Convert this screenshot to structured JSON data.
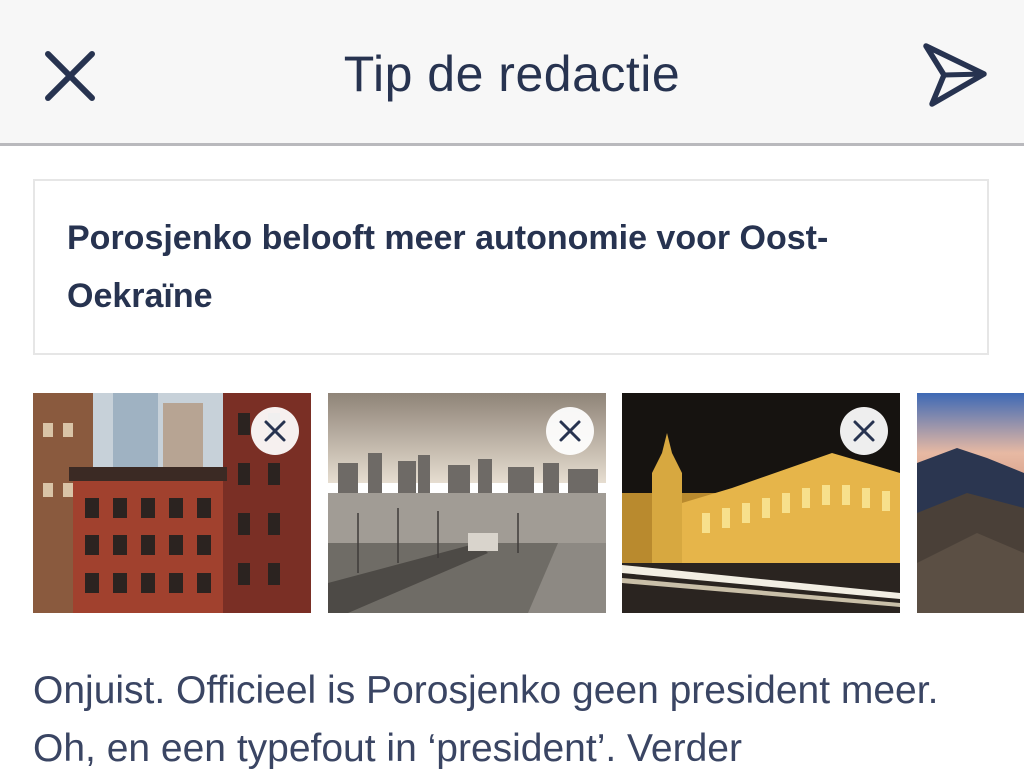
{
  "navbar": {
    "title": "Tip de redactie",
    "close_icon": "close-icon",
    "send_icon": "send-icon"
  },
  "headline": {
    "text": "Porosjenko belooft meer autonomie voor Oost-Oekraïne"
  },
  "photos": [
    {
      "subject": "red brick apartment buildings",
      "removable": true
    },
    {
      "subject": "harbor with boats and city skyline",
      "removable": true
    },
    {
      "subject": "illuminated historic building at night",
      "removable": true
    },
    {
      "subject": "mountain landscape at dusk",
      "removable": false
    }
  ],
  "comment": {
    "text": "Onjuist. Officieel is Porosjenko geen president meer. Oh, en een typefout in ‘president’. Verder"
  },
  "colors": {
    "text_primary": "#273350",
    "navbar_bg": "#f7f7f7",
    "navbar_border": "#b9b9bd"
  }
}
